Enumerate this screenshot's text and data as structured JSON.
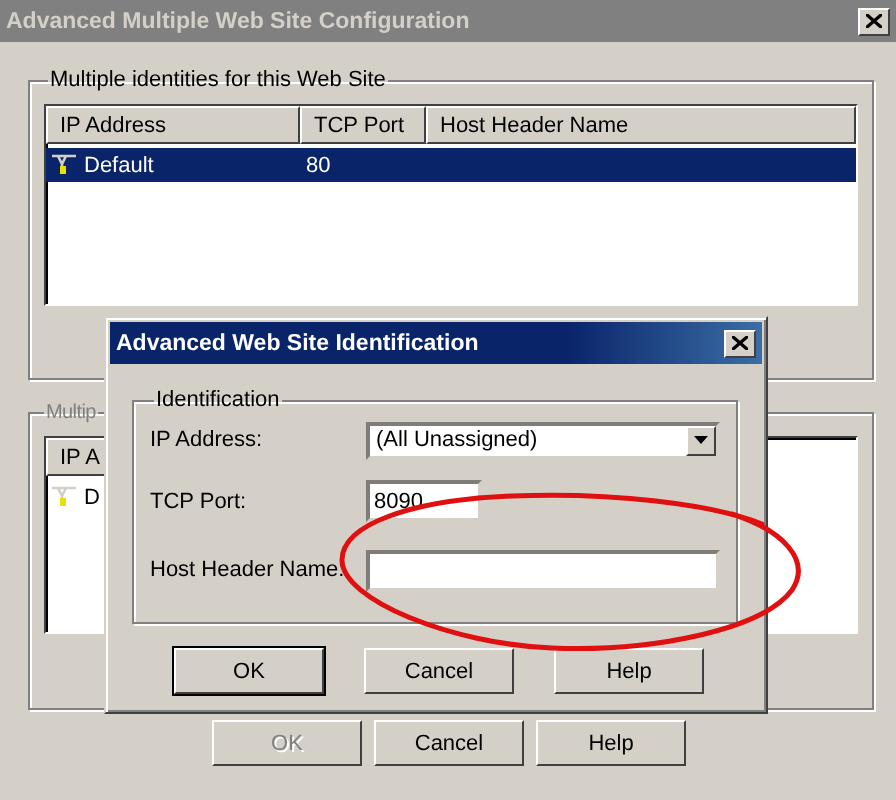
{
  "window": {
    "title": "Advanced Multiple Web Site Configuration",
    "active": false
  },
  "identities_group": {
    "label": "Multiple identities for this Web Site",
    "columns": [
      "IP Address",
      "TCP Port",
      "Host Header Name"
    ],
    "rows": [
      {
        "ip": "Default",
        "port": "80",
        "selected": true
      }
    ]
  },
  "second_group": {
    "label": "Multip",
    "columns": [
      "IP A"
    ],
    "rows": [
      {
        "ip": "D",
        "selected": false
      }
    ]
  },
  "buttons": [
    {
      "label": "OK",
      "disabled": true
    },
    {
      "label": "Cancel",
      "disabled": false
    },
    {
      "label": "Help",
      "disabled": false
    }
  ],
  "dialog": {
    "title": "Advanced Web Site Identification",
    "active": true,
    "group_label": "Identification",
    "fields": [
      {
        "kind": "select",
        "label": "IP Address:",
        "value": "(All Unassigned)"
      },
      {
        "kind": "text",
        "label": "TCP Port:",
        "value": "8090"
      },
      {
        "kind": "text",
        "label": "Host Header Name:"
      }
    ],
    "buttons": [
      {
        "label": "OK",
        "default": true
      },
      {
        "label": "Cancel",
        "default": false
      },
      {
        "label": "Help",
        "default": false
      }
    ]
  }
}
